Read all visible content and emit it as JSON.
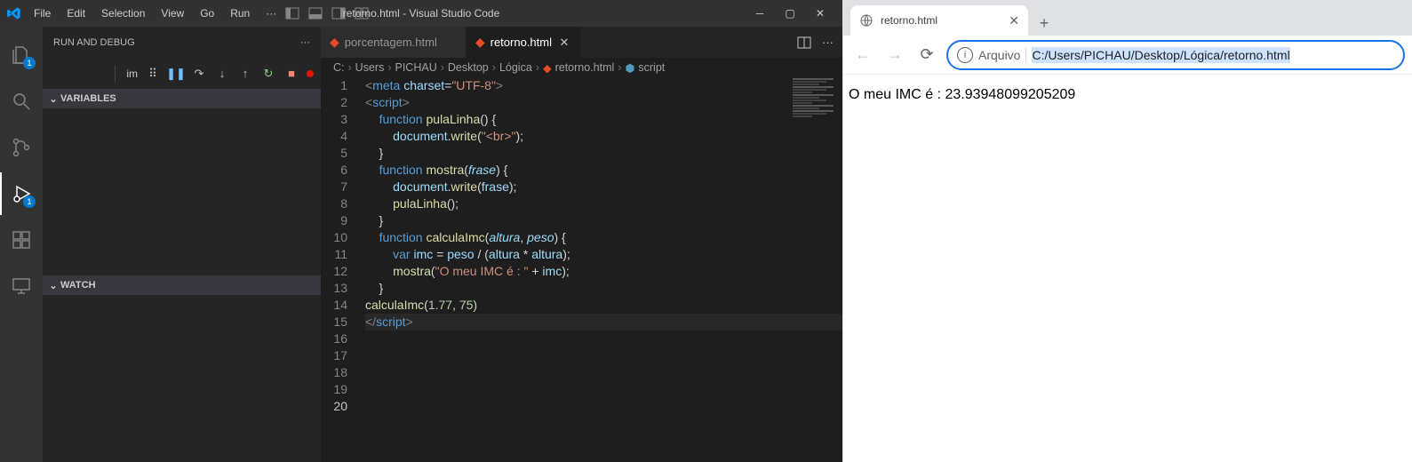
{
  "vscode": {
    "menu": [
      "File",
      "Edit",
      "Selection",
      "View",
      "Go",
      "Run",
      "···"
    ],
    "title": "retorno.html - Visual Studio Code",
    "activity_badges": {
      "explorer": "1",
      "debug": "1"
    },
    "sidebar": {
      "title": "RUN AND DEBUG",
      "sections": [
        "VARIABLES",
        "WATCH"
      ]
    },
    "debug_label": "im",
    "tabs": [
      {
        "label": "porcentagem.html",
        "active": false
      },
      {
        "label": "retorno.html",
        "active": true
      }
    ],
    "breadcrumb": [
      "C:",
      "Users",
      "PICHAU",
      "Desktop",
      "Lógica",
      "retorno.html",
      "script"
    ],
    "code_lines": 20,
    "code": {
      "l1": {
        "a": "<",
        "b": "meta",
        "c": " ",
        "d": "charset",
        "e": "=",
        "f": "\"UTF-8\"",
        "g": ">"
      },
      "l2": {
        "a": "<",
        "b": "script",
        "c": ">"
      },
      "l3": {
        "kw": "function",
        "sp": " ",
        "fn": "pulaLinha",
        "p": "() {"
      },
      "l4": {
        "obj": "document",
        "dot": ".",
        "fn": "write",
        "p": "(",
        "s": "\"<br>\"",
        "e": ");"
      },
      "l5": "}",
      "l6": "",
      "l7": {
        "kw": "function",
        "sp": " ",
        "fn": "mostra",
        "p1": "(",
        "arg": "frase",
        "p2": ") {"
      },
      "l8": {
        "obj": "document",
        "dot": ".",
        "fn": "write",
        "p": "(",
        "v": "frase",
        "e": ");"
      },
      "l9": {
        "fn": "pulaLinha",
        "p": "();"
      },
      "l10": "}",
      "l11": "",
      "l12": {
        "kw": "function",
        "sp": " ",
        "fn": "calculaImc",
        "p1": "(",
        "a1": "altura",
        "c": ", ",
        "a2": "peso",
        "p2": ") {"
      },
      "l13": "",
      "l14": {
        "kw": "var",
        "sp": " ",
        "v1": "imc",
        "eq": " = ",
        "v2": "peso",
        "op": " / (",
        "v3": "altura",
        "op2": " * ",
        "v4": "altura",
        "e": ");"
      },
      "l15": {
        "fn": "mostra",
        "p": "(",
        "s": "\"O meu IMC é : \"",
        "op": " + ",
        "v": "imc",
        "e": ");"
      },
      "l16": "}",
      "l17": "",
      "l18": {
        "fn": "calculaImc",
        "p": "(",
        "n1": "1.77",
        "c": ", ",
        "n2": "75",
        "e": ")"
      },
      "l19": "",
      "l20": {
        "a": "</",
        "b": "script",
        "c": ">"
      }
    }
  },
  "browser": {
    "tab_title": "retorno.html",
    "addr_proto": "Arquivo",
    "addr_url": "C:/Users/PICHAU/Desktop/Lógica/retorno.html",
    "content": "O meu IMC é : 23.93948099205209"
  }
}
